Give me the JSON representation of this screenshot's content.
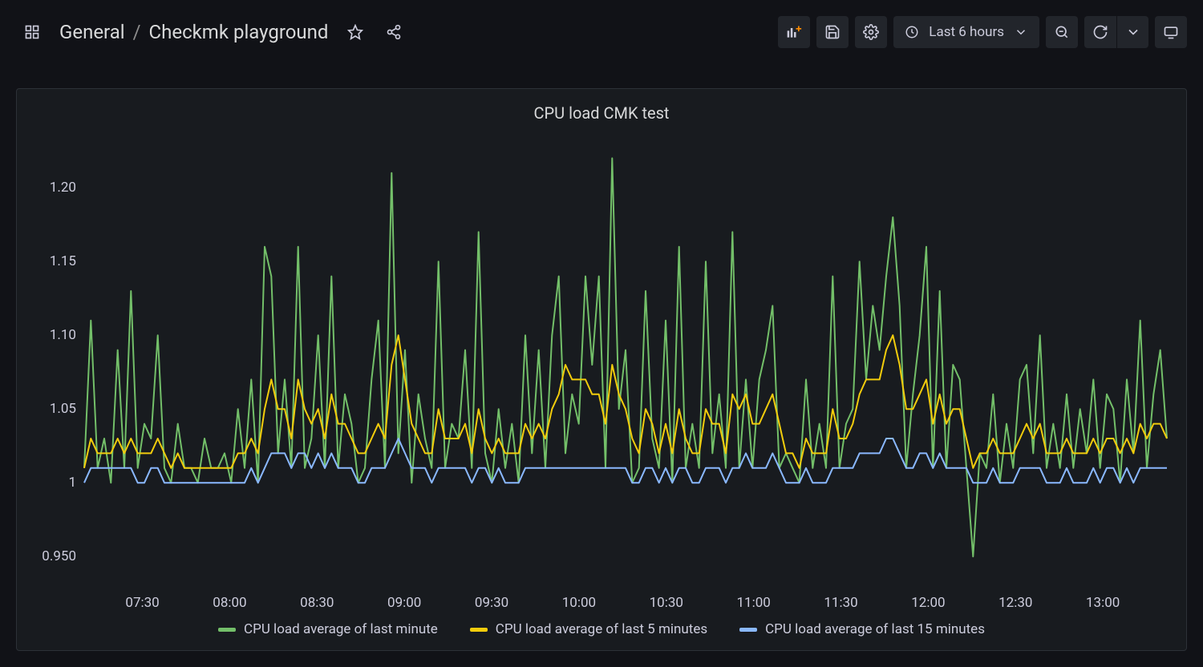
{
  "breadcrumb": {
    "folder": "General",
    "sep": "/",
    "title": "Checkmk playground"
  },
  "time_picker": {
    "label": "Last 6 hours"
  },
  "panel": {
    "title": "CPU load CMK test"
  },
  "legend": {
    "s1": "CPU load average of last minute",
    "s2": "CPU load average of last 5 minutes",
    "s3": "CPU load average of last 15 minutes"
  },
  "colors": {
    "s1": "#73bf69",
    "s2": "#f2cc0c",
    "s3": "#8ab8ff"
  },
  "chart_data": {
    "type": "line",
    "title": "CPU load CMK test",
    "xlabel": "",
    "ylabel": "",
    "ylim": [
      0.93,
      1.23
    ],
    "y_ticks": [
      0.95,
      1.0,
      1.05,
      1.1,
      1.15,
      1.2
    ],
    "y_tick_labels": [
      "0.950",
      "1",
      "1.05",
      "1.10",
      "1.15",
      "1.20"
    ],
    "x_ticks": [
      "07:30",
      "08:00",
      "08:30",
      "09:00",
      "09:30",
      "10:00",
      "10:30",
      "11:00",
      "11:30",
      "12:00",
      "12:30",
      "13:00"
    ],
    "x_range_minutes": [
      430,
      802
    ],
    "series": [
      {
        "name": "CPU load average of last minute",
        "color": "#73bf69",
        "values": [
          1.01,
          1.11,
          1.01,
          1.03,
          1.0,
          1.09,
          1.01,
          1.13,
          1.01,
          1.04,
          1.03,
          1.1,
          1.01,
          1.0,
          1.04,
          1.01,
          1.01,
          1.0,
          1.03,
          1.01,
          1.01,
          1.02,
          1.0,
          1.05,
          1.01,
          1.07,
          1.0,
          1.16,
          1.14,
          1.02,
          1.07,
          1.01,
          1.16,
          1.01,
          1.03,
          1.1,
          1.01,
          1.14,
          1.01,
          1.06,
          1.04,
          1.0,
          1.01,
          1.07,
          1.11,
          1.01,
          1.21,
          1.02,
          1.09,
          1.0,
          1.06,
          1.03,
          1.01,
          1.15,
          1.01,
          1.04,
          1.03,
          1.09,
          1.01,
          1.17,
          1.02,
          1.0,
          1.05,
          1.01,
          1.04,
          1.0,
          1.1,
          1.02,
          1.09,
          1.01,
          1.1,
          1.14,
          1.02,
          1.06,
          1.04,
          1.14,
          1.08,
          1.14,
          1.01,
          1.22,
          1.05,
          1.09,
          1.0,
          1.01,
          1.13,
          1.03,
          1.01,
          1.11,
          1.0,
          1.16,
          1.01,
          1.04,
          1.01,
          1.15,
          1.02,
          1.06,
          1.01,
          1.17,
          1.01,
          1.07,
          1.01,
          1.07,
          1.09,
          1.12,
          1.01,
          1.02,
          1.01,
          1.0,
          1.07,
          1.01,
          1.04,
          1.01,
          1.14,
          1.01,
          1.04,
          1.05,
          1.15,
          1.07,
          1.12,
          1.09,
          1.14,
          1.18,
          1.12,
          1.01,
          1.06,
          1.1,
          1.16,
          1.01,
          1.13,
          1.01,
          1.08,
          1.07,
          1.01,
          0.95,
          1.02,
          1.01,
          1.06,
          1.0,
          1.04,
          1.01,
          1.07,
          1.08,
          1.02,
          1.1,
          1.01,
          1.04,
          1.01,
          1.06,
          1.01,
          1.05,
          1.02,
          1.07,
          1.01,
          1.06,
          1.05,
          1.0,
          1.07,
          1.02,
          1.11,
          1.01,
          1.06,
          1.09,
          1.03
        ]
      },
      {
        "name": "CPU load average of last 5 minutes",
        "color": "#f2cc0c",
        "values": [
          1.01,
          1.03,
          1.02,
          1.02,
          1.02,
          1.03,
          1.02,
          1.03,
          1.02,
          1.02,
          1.02,
          1.03,
          1.02,
          1.01,
          1.02,
          1.01,
          1.01,
          1.01,
          1.01,
          1.01,
          1.01,
          1.01,
          1.01,
          1.02,
          1.02,
          1.03,
          1.02,
          1.05,
          1.07,
          1.05,
          1.05,
          1.03,
          1.07,
          1.05,
          1.04,
          1.05,
          1.03,
          1.06,
          1.04,
          1.04,
          1.03,
          1.02,
          1.02,
          1.03,
          1.04,
          1.03,
          1.08,
          1.1,
          1.07,
          1.04,
          1.03,
          1.02,
          1.02,
          1.05,
          1.03,
          1.03,
          1.03,
          1.04,
          1.02,
          1.05,
          1.03,
          1.02,
          1.03,
          1.02,
          1.02,
          1.02,
          1.04,
          1.03,
          1.04,
          1.03,
          1.05,
          1.06,
          1.08,
          1.07,
          1.07,
          1.07,
          1.06,
          1.06,
          1.04,
          1.08,
          1.06,
          1.05,
          1.03,
          1.02,
          1.05,
          1.04,
          1.02,
          1.04,
          1.02,
          1.05,
          1.03,
          1.02,
          1.02,
          1.05,
          1.04,
          1.04,
          1.02,
          1.06,
          1.05,
          1.06,
          1.04,
          1.04,
          1.05,
          1.06,
          1.04,
          1.02,
          1.02,
          1.01,
          1.03,
          1.02,
          1.02,
          1.02,
          1.05,
          1.03,
          1.03,
          1.04,
          1.06,
          1.07,
          1.07,
          1.07,
          1.09,
          1.1,
          1.08,
          1.05,
          1.05,
          1.06,
          1.07,
          1.04,
          1.06,
          1.04,
          1.05,
          1.05,
          1.03,
          1.01,
          1.02,
          1.02,
          1.03,
          1.02,
          1.02,
          1.02,
          1.03,
          1.04,
          1.03,
          1.04,
          1.02,
          1.02,
          1.02,
          1.03,
          1.02,
          1.02,
          1.02,
          1.03,
          1.02,
          1.03,
          1.03,
          1.02,
          1.03,
          1.02,
          1.04,
          1.03,
          1.04,
          1.04,
          1.03
        ]
      },
      {
        "name": "CPU load average of last 15 minutes",
        "color": "#8ab8ff",
        "values": [
          1.0,
          1.01,
          1.01,
          1.01,
          1.01,
          1.01,
          1.01,
          1.01,
          1.0,
          1.0,
          1.01,
          1.01,
          1.0,
          1.0,
          1.0,
          1.0,
          1.0,
          1.0,
          1.0,
          1.0,
          1.0,
          1.0,
          1.0,
          1.0,
          1.0,
          1.01,
          1.0,
          1.01,
          1.02,
          1.02,
          1.02,
          1.01,
          1.02,
          1.02,
          1.01,
          1.02,
          1.01,
          1.02,
          1.01,
          1.01,
          1.01,
          1.0,
          1.0,
          1.01,
          1.01,
          1.01,
          1.02,
          1.03,
          1.02,
          1.01,
          1.01,
          1.01,
          1.0,
          1.01,
          1.01,
          1.01,
          1.01,
          1.01,
          1.0,
          1.01,
          1.01,
          1.0,
          1.01,
          1.0,
          1.0,
          1.0,
          1.01,
          1.01,
          1.01,
          1.01,
          1.01,
          1.01,
          1.01,
          1.01,
          1.01,
          1.01,
          1.01,
          1.01,
          1.01,
          1.01,
          1.01,
          1.01,
          1.0,
          1.0,
          1.01,
          1.01,
          1.0,
          1.01,
          1.0,
          1.01,
          1.01,
          1.0,
          1.0,
          1.01,
          1.01,
          1.01,
          1.0,
          1.01,
          1.01,
          1.02,
          1.01,
          1.01,
          1.01,
          1.02,
          1.01,
          1.0,
          1.0,
          1.0,
          1.01,
          1.0,
          1.0,
          1.0,
          1.01,
          1.01,
          1.01,
          1.01,
          1.02,
          1.02,
          1.02,
          1.02,
          1.03,
          1.03,
          1.02,
          1.01,
          1.01,
          1.02,
          1.02,
          1.01,
          1.02,
          1.01,
          1.01,
          1.01,
          1.01,
          1.0,
          1.0,
          1.0,
          1.01,
          1.0,
          1.0,
          1.0,
          1.01,
          1.01,
          1.01,
          1.01,
          1.0,
          1.0,
          1.0,
          1.01,
          1.0,
          1.0,
          1.0,
          1.01,
          1.0,
          1.01,
          1.01,
          1.0,
          1.01,
          1.0,
          1.01,
          1.01,
          1.01,
          1.01,
          1.01
        ]
      }
    ]
  }
}
